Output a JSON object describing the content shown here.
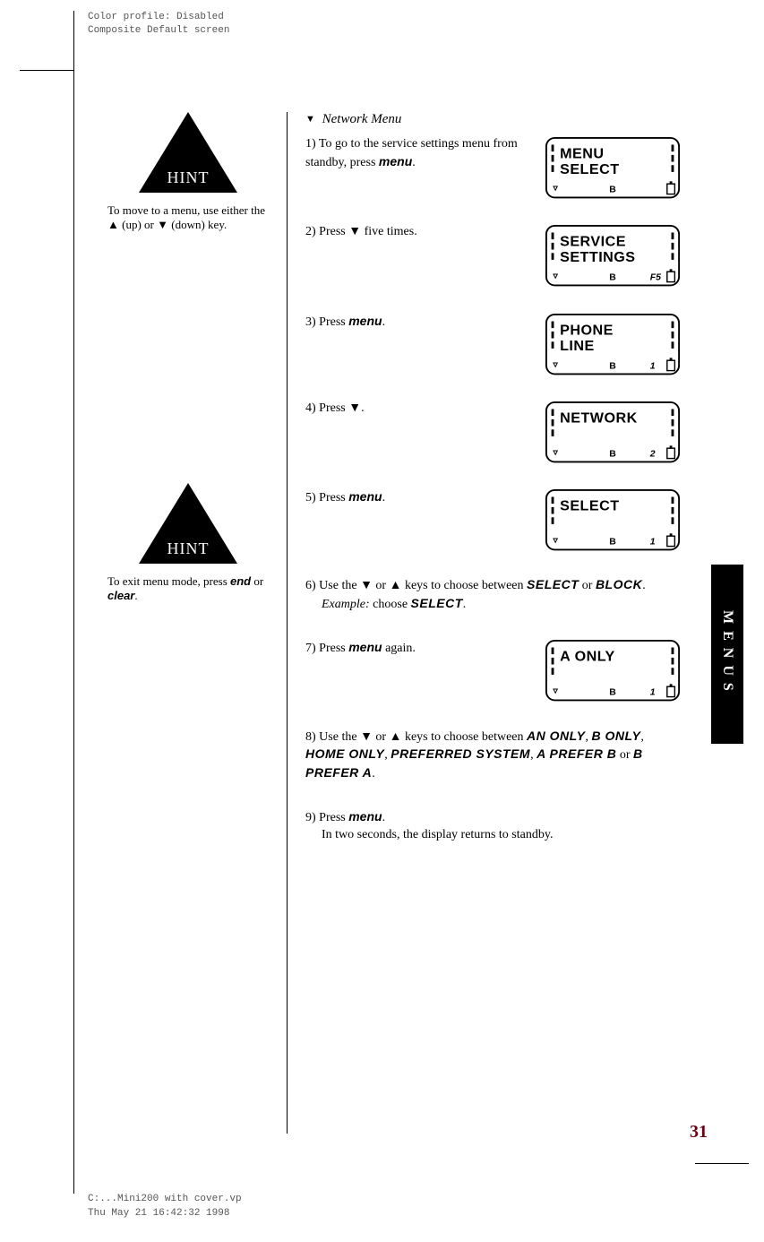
{
  "print_meta": {
    "top_line1": "Color profile: Disabled",
    "top_line2": "Composite  Default screen",
    "bottom_line1": "C:...Mini200 with cover.vp",
    "bottom_line2": "Thu May 21 16:42:32 1998"
  },
  "sidebar": {
    "hint_label": "HINT",
    "hint1_text_parts": [
      "To move to a menu, use either the ",
      "▲",
      " (up) or ",
      "▼",
      " (down) key."
    ],
    "hint2_text_parts": [
      "To exit menu mode, press ",
      "end",
      " or ",
      "clear",
      "."
    ]
  },
  "section": {
    "title": "Network Menu",
    "steps": [
      {
        "n": "1)",
        "text_parts": [
          "To go to the service settings menu from standby, press ",
          {
            "cls": "menukw",
            "t": "menu"
          },
          "."
        ]
      },
      {
        "n": "2)",
        "text_parts": [
          "Press ",
          "▼",
          " five times."
        ]
      },
      {
        "n": "3)",
        "text_parts": [
          "Press ",
          {
            "cls": "menukw",
            "t": "menu"
          },
          "."
        ]
      },
      {
        "n": "4)",
        "text_parts": [
          "Press ",
          "▼",
          "."
        ]
      },
      {
        "n": "5)",
        "text_parts": [
          "Press ",
          {
            "cls": "menukw",
            "t": "menu"
          },
          "."
        ]
      },
      {
        "n": "6)",
        "text_parts": [
          "Use the ",
          "▼",
          " or ",
          "▲",
          " keys to choose between ",
          {
            "cls": "lcdkw",
            "t": "SELECT"
          },
          " or ",
          {
            "cls": "lcdkw",
            "t": "BLOCK"
          },
          "."
        ],
        "sub_parts": [
          {
            "i": true,
            "t": "Example:"
          },
          " choose ",
          {
            "cls": "lcdkw",
            "t": "SELECT"
          },
          "."
        ]
      },
      {
        "n": "7)",
        "text_parts": [
          "Press ",
          {
            "cls": "menukw",
            "t": "menu"
          },
          " again."
        ]
      },
      {
        "n": "8)",
        "text_parts": [
          "Use the ",
          "▼",
          " or ",
          "▲",
          " keys to choose between ",
          {
            "cls": "lcdkw",
            "t": "AN ONLY"
          },
          ", ",
          {
            "cls": "lcdkw",
            "t": "B ONLY"
          },
          ", ",
          {
            "cls": "lcdkw",
            "t": "HOME ONLY"
          },
          ", ",
          {
            "cls": "lcdkw",
            "t": "PREFERRED SYSTEM"
          },
          ", ",
          {
            "cls": "lcdkw",
            "t": "A PREFER B"
          },
          " or ",
          {
            "cls": "lcdkw",
            "t": "B PREFER A"
          },
          "."
        ]
      },
      {
        "n": "9)",
        "text_parts": [
          "Press ",
          {
            "cls": "menukw",
            "t": "menu"
          },
          "."
        ],
        "sub_plain": "In two seconds, the display returns to standby."
      }
    ]
  },
  "lcd": [
    {
      "line1": "MENU",
      "line2": "SELECT",
      "b": "B",
      "right": ""
    },
    {
      "line1": "SERVICE",
      "line2": "SETTINGS",
      "b": "B",
      "right": "F5"
    },
    {
      "line1": "PHONE",
      "line2": "LINE",
      "b": "B",
      "right": "1"
    },
    {
      "line1": "NETWORK",
      "line2": "",
      "b": "B",
      "right": "2"
    },
    {
      "line1": "SELECT",
      "line2": "",
      "b": "B",
      "right": "1"
    },
    {
      "line1": "A ONLY",
      "line2": "",
      "b": "B",
      "right": "1"
    }
  ],
  "side_tab": "MENUS",
  "page_number": "31"
}
